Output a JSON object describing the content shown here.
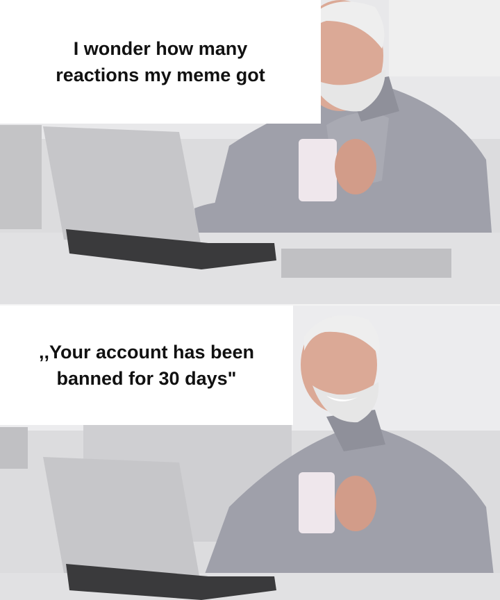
{
  "panels": [
    {
      "caption": "I wonder how many\nreactions my meme got"
    },
    {
      "caption": ",,Your account has been\nbanned for 30 days\""
    }
  ],
  "colors": {
    "background": "#ffffff",
    "caption_text": "#111111",
    "wall": "#d9d9da",
    "shirt": "#9c9ca6",
    "laptop": "#c9c9cc",
    "desk": "#e2e2e4"
  }
}
